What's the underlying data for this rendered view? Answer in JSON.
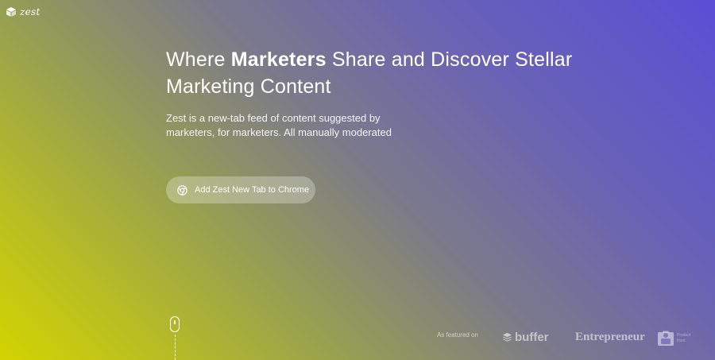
{
  "brand": {
    "name": "zest",
    "logo_icon": "cube-icon"
  },
  "hero": {
    "headline_pre": "Where ",
    "headline_strong": "Marketers",
    "headline_post": " Share and Discover Stellar Marketing Content",
    "subtitle": "Zest is a new-tab feed of content suggested by marketers, for marketers. All manually moderated"
  },
  "cta": {
    "label": "Add Zest New Tab to Chrome",
    "icon": "chrome-icon"
  },
  "scroll": {
    "icon": "mouse-scroll-icon"
  },
  "featured": {
    "label": "As featured on",
    "logos": [
      {
        "name": "buffer",
        "icon": "buffer-stack-icon"
      },
      {
        "name": "Entrepreneur"
      },
      {
        "name": "Product Hunt",
        "icon": "product-hunt-kitty-icon"
      }
    ]
  },
  "colors": {
    "gradient_top_right": "#5a4fd6",
    "gradient_bottom_left": "#d2d400",
    "button_fill": "rgba(255,255,255,0.28)"
  }
}
